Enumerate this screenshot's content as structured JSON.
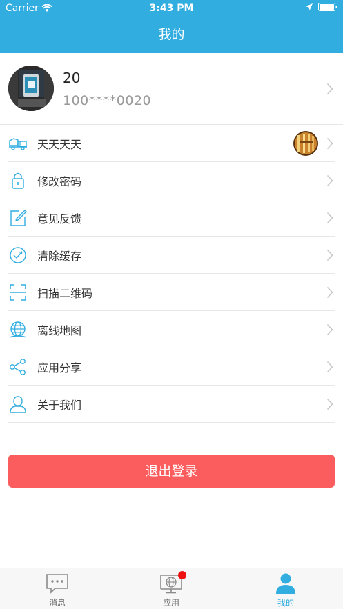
{
  "status_bar": {
    "carrier": "Carrier",
    "time": "3:43 PM"
  },
  "nav": {
    "title": "我的"
  },
  "profile": {
    "name": "20",
    "account": "100****0020"
  },
  "menu": [
    {
      "label": "天天天天",
      "icon": "truck-icon"
    },
    {
      "label": "修改密码",
      "icon": "lock-icon"
    },
    {
      "label": "意见反馈",
      "icon": "edit-icon"
    },
    {
      "label": "清除缓存",
      "icon": "clear-icon"
    },
    {
      "label": "扫描二维码",
      "icon": "scan-icon"
    },
    {
      "label": "离线地图",
      "icon": "globe-icon"
    },
    {
      "label": "应用分享",
      "icon": "share-icon"
    },
    {
      "label": "关于我们",
      "icon": "user-icon"
    }
  ],
  "logout_label": "退出登录",
  "tabs": [
    {
      "label": "消息",
      "icon": "message-icon",
      "active": false
    },
    {
      "label": "应用",
      "icon": "apps-icon",
      "active": false
    },
    {
      "label": "我的",
      "icon": "person-icon",
      "active": true
    }
  ],
  "colors": {
    "primary": "#31ade0",
    "logout": "#fb5c5d",
    "badge": "#ee1111"
  }
}
